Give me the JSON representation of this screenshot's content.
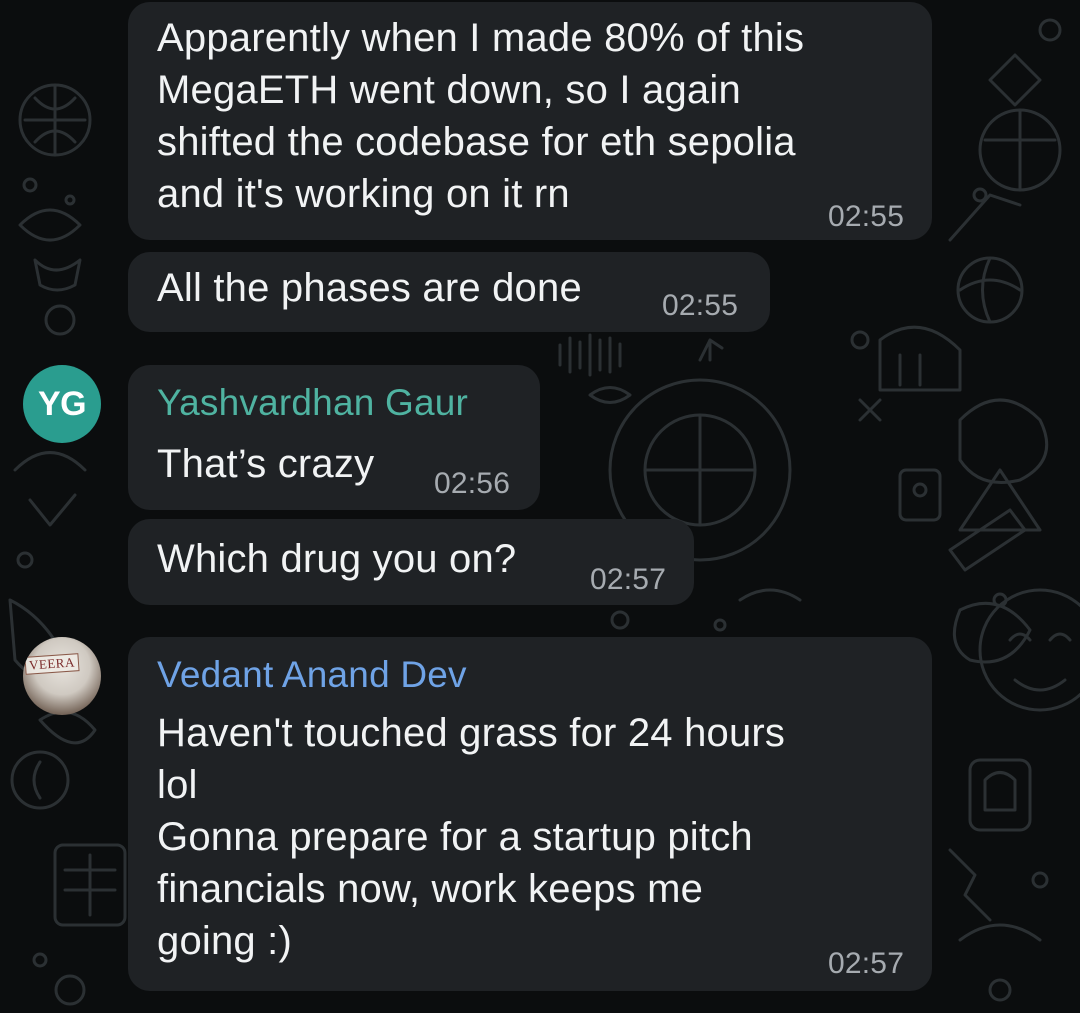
{
  "theme": {
    "background": "#0b0d0e",
    "bubble": "#1f2225",
    "text": "#f1f3f4",
    "timestamp": "#a6abb0"
  },
  "messages": [
    {
      "text": "Apparently when I made 80% of this\nMegaETH went down, so I again\nshifted the codebase for eth sepolia\nand it's working on it rn",
      "time": "02:55"
    },
    {
      "text": "All the phases are done",
      "time": "02:55"
    },
    {
      "sender": "Yashvardhan Gaur",
      "sender_color": "#4fb3a1",
      "avatar_initials": "YG",
      "avatar_color": "#2a9d8f",
      "text": "That’s crazy",
      "time": "02:56"
    },
    {
      "text": "Which drug you on?",
      "time": "02:57"
    },
    {
      "sender": "Vedant Anand Dev",
      "sender_color": "#6fa3e6",
      "avatar_photo_label": "VEERA",
      "text": "Haven't touched grass for 24 hours\nlol\nGonna prepare for a startup pitch\nfinancials now, work keeps me\ngoing :)",
      "time": "02:57"
    }
  ]
}
